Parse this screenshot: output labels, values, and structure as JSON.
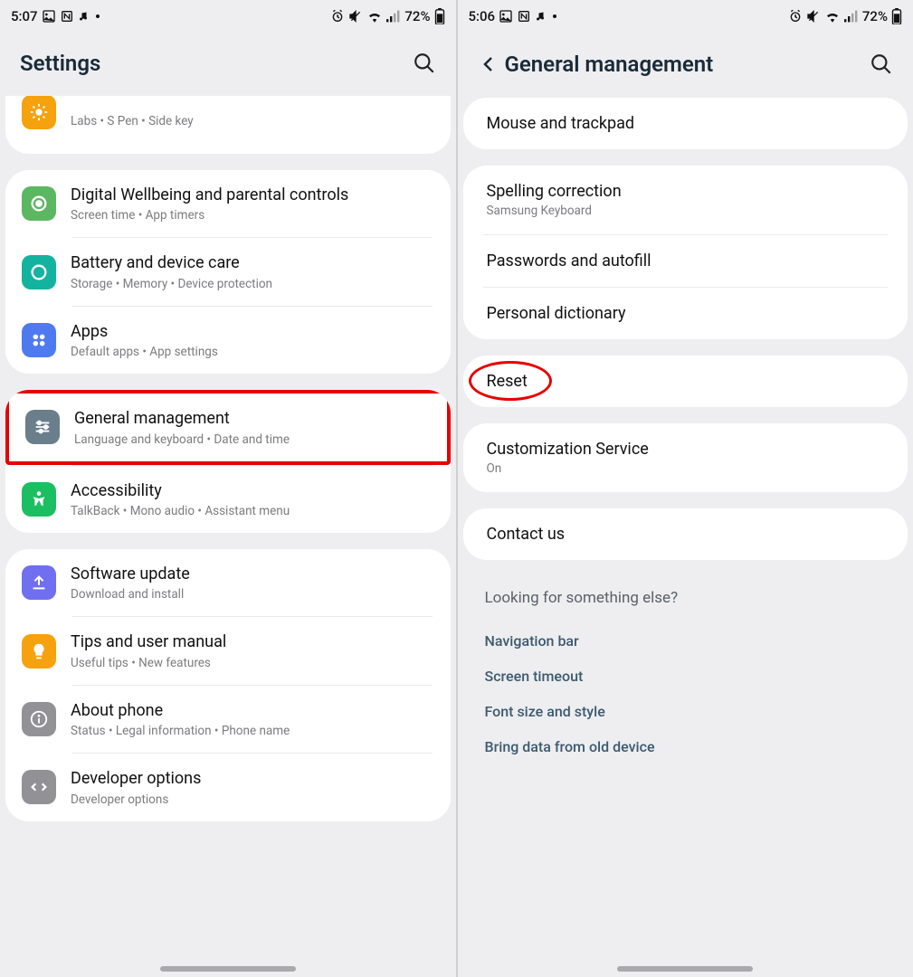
{
  "left": {
    "status": {
      "time": "5:07",
      "battery": "72%"
    },
    "header": {
      "title": "Settings"
    },
    "group0": {
      "advanced": {
        "sub": "Labs  •  S Pen  •  Side key"
      }
    },
    "group1": {
      "wellbeing": {
        "title": "Digital Wellbeing and parental controls",
        "sub": "Screen time  •  App timers"
      },
      "battery": {
        "title": "Battery and device care",
        "sub": "Storage  •  Memory  •  Device protection"
      },
      "apps": {
        "title": "Apps",
        "sub": "Default apps  •  App settings"
      }
    },
    "group2": {
      "general": {
        "title": "General management",
        "sub": "Language and keyboard  •  Date and time"
      },
      "access": {
        "title": "Accessibility",
        "sub": "TalkBack  •  Mono audio  •  Assistant menu"
      }
    },
    "group3": {
      "update": {
        "title": "Software update",
        "sub": "Download and install"
      },
      "tips": {
        "title": "Tips and user manual",
        "sub": "Useful tips  •  New features"
      },
      "about": {
        "title": "About phone",
        "sub": "Status  •  Legal information  •  Phone name"
      },
      "dev": {
        "title": "Developer options",
        "sub": "Developer options"
      }
    }
  },
  "right": {
    "status": {
      "time": "5:06",
      "battery": "72%"
    },
    "header": {
      "title": "General management"
    },
    "groupA": {
      "mouse": {
        "title": "Mouse and trackpad"
      }
    },
    "groupB": {
      "spell": {
        "title": "Spelling correction",
        "sub": "Samsung Keyboard"
      },
      "pass": {
        "title": "Passwords and autofill"
      },
      "dict": {
        "title": "Personal dictionary"
      }
    },
    "groupC": {
      "reset": {
        "title": "Reset"
      }
    },
    "groupD": {
      "cust": {
        "title": "Customization Service",
        "sub": "On"
      }
    },
    "groupE": {
      "contact": {
        "title": "Contact us"
      }
    },
    "suggest": {
      "heading": "Looking for something else?",
      "links": [
        "Navigation bar",
        "Screen timeout",
        "Font size and style",
        "Bring data from old device"
      ]
    }
  }
}
